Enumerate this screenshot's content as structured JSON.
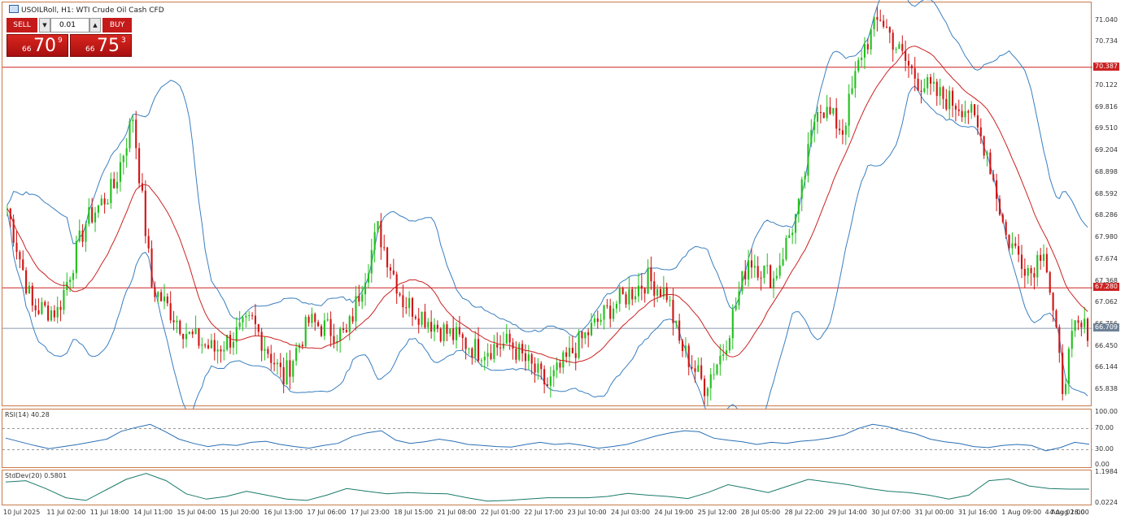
{
  "header": {
    "title": "USOILRoll, H1: WTI Crude Oil Cash CFD"
  },
  "trade_panel": {
    "sell_label": "SELL",
    "buy_label": "BUY",
    "lot": "0.01",
    "sell_small": "66",
    "sell_big": "70",
    "sell_sup": "9",
    "buy_small": "66",
    "buy_big": "75",
    "buy_sup": "3",
    "down_arrow": "▼",
    "up_arrow": "▲"
  },
  "colors": {
    "bull": "#22c01c",
    "bear": "#d01515",
    "band": "#3a7fc0",
    "ma": "#cc2222",
    "hline": "#cc2222",
    "bid": "#8899aa",
    "osc": "#2a6fb5",
    "std": "#1a7a6a"
  },
  "chart_data": [
    {
      "type": "candlestick",
      "title": "USOILRoll, H1: WTI Crude Oil Cash CFD",
      "ylim": [
        65.6,
        71.3
      ],
      "price_ticks": [
        "71.040",
        "70.734",
        "70.122",
        "69.816",
        "69.510",
        "69.204",
        "68.898",
        "68.592",
        "68.286",
        "67.980",
        "67.674",
        "67.368",
        "67.062",
        "66.756",
        "66.450",
        "66.144",
        "65.838"
      ],
      "x_ticks": [
        "10 Jul 2025",
        "11 Jul 02:00",
        "11 Jul 18:00",
        "14 Jul 11:00",
        "15 Jul 04:00",
        "15 Jul 20:00",
        "16 Jul 13:00",
        "17 Jul 06:00",
        "17 Jul 23:00",
        "18 Jul 15:00",
        "21 Jul 08:00",
        "22 Jul 01:00",
        "22 Jul 17:00",
        "23 Jul 10:00",
        "24 Jul 03:00",
        "24 Jul 19:00",
        "25 Jul 12:00",
        "28 Jul 05:00",
        "28 Jul 22:00",
        "29 Jul 14:00",
        "30 Jul 07:00",
        "31 Jul 00:00",
        "31 Jul 16:00",
        "1 Aug 09:00",
        "4 Aug 02:00",
        "4 Aug 18:00"
      ],
      "anchors": [
        [
          0,
          68.4
        ],
        [
          8,
          67.0
        ],
        [
          16,
          66.95
        ],
        [
          25,
          68.2
        ],
        [
          34,
          68.7
        ],
        [
          40,
          69.7
        ],
        [
          46,
          67.3
        ],
        [
          58,
          66.6
        ],
        [
          66,
          66.4
        ],
        [
          78,
          66.8
        ],
        [
          88,
          66.0
        ],
        [
          96,
          66.8
        ],
        [
          108,
          66.6
        ],
        [
          118,
          68.1
        ],
        [
          126,
          67.1
        ],
        [
          138,
          66.7
        ],
        [
          150,
          66.4
        ],
        [
          160,
          66.5
        ],
        [
          172,
          65.9
        ],
        [
          182,
          66.5
        ],
        [
          192,
          67.0
        ],
        [
          204,
          67.4
        ],
        [
          210,
          67.2
        ],
        [
          214,
          66.5
        ],
        [
          222,
          65.9
        ],
        [
          228,
          66.4
        ],
        [
          236,
          67.7
        ],
        [
          244,
          67.4
        ],
        [
          252,
          68.4
        ],
        [
          258,
          69.9
        ],
        [
          266,
          69.5
        ],
        [
          272,
          70.6
        ],
        [
          278,
          71.1
        ],
        [
          284,
          70.6
        ],
        [
          290,
          70.2
        ],
        [
          296,
          70.0
        ],
        [
          306,
          69.8
        ],
        [
          312,
          69.2
        ],
        [
          318,
          68.0
        ],
        [
          326,
          67.5
        ],
        [
          330,
          67.9
        ],
        [
          336,
          65.9
        ],
        [
          340,
          66.7
        ],
        [
          344,
          66.7
        ]
      ],
      "horizontal_lines": [
        {
          "price": 70.387,
          "label": "70.387"
        },
        {
          "price": 67.28,
          "label": "67.280"
        }
      ],
      "bid_line": {
        "price": 66.709,
        "label": "66.709"
      }
    },
    {
      "type": "line",
      "title": "RSI(14) 40.28",
      "ylim": [
        0,
        100
      ],
      "y_ticks": [
        "100.00",
        "70.00",
        "30.00",
        "0.00"
      ],
      "levels": [
        70,
        30
      ],
      "values": [
        52,
        45,
        38,
        32,
        36,
        40,
        45,
        50,
        65,
        72,
        78,
        65,
        50,
        42,
        36,
        40,
        38,
        44,
        46,
        40,
        36,
        33,
        38,
        42,
        55,
        62,
        66,
        48,
        42,
        45,
        50,
        46,
        40,
        38,
        36,
        35,
        40,
        44,
        40,
        42,
        38,
        33,
        36,
        40,
        48,
        56,
        62,
        66,
        64,
        52,
        48,
        45,
        40,
        44,
        42,
        46,
        48,
        52,
        58,
        70,
        78,
        74,
        66,
        60,
        50,
        45,
        42,
        36,
        34,
        38,
        40,
        38,
        28,
        34,
        44,
        40.28
      ]
    },
    {
      "type": "line",
      "title": "StdDev(20) 0.5801",
      "ylim": [
        0.0224,
        1.1984
      ],
      "y_ticks": [
        "1.1984",
        "0.0224"
      ],
      "values": [
        0.85,
        0.9,
        0.6,
        0.25,
        0.15,
        0.55,
        0.95,
        1.18,
        0.9,
        0.4,
        0.2,
        0.3,
        0.5,
        0.35,
        0.2,
        0.15,
        0.35,
        0.6,
        0.5,
        0.4,
        0.45,
        0.42,
        0.4,
        0.25,
        0.12,
        0.15,
        0.2,
        0.25,
        0.25,
        0.25,
        0.3,
        0.42,
        0.35,
        0.3,
        0.22,
        0.45,
        0.75,
        0.6,
        0.45,
        0.7,
        0.95,
        0.85,
        0.75,
        0.6,
        0.5,
        0.45,
        0.35,
        0.2,
        0.35,
        0.9,
        0.97,
        0.7,
        0.6,
        0.58,
        0.5801
      ]
    }
  ]
}
